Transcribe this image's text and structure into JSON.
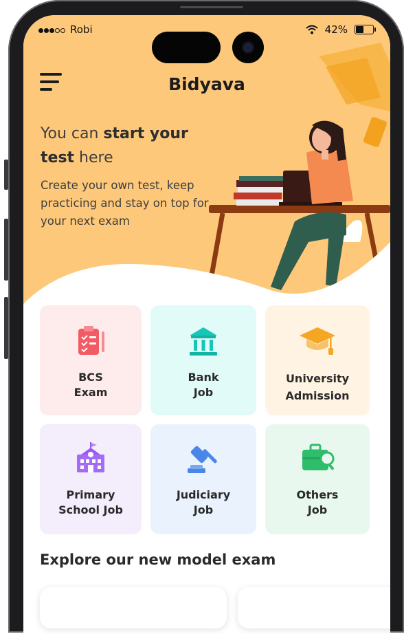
{
  "status_bar": {
    "carrier": "Robi",
    "battery": "42%"
  },
  "header": {
    "title": "Bidyava"
  },
  "hero": {
    "headline_prefix": "You can ",
    "headline_bold_1": "start your",
    "headline_bold_2": "test",
    "headline_suffix": " here",
    "subtext": "Create your own test, keep practicing and stay on top for your next exam"
  },
  "categories": [
    {
      "line1": "BCS",
      "line2": "Exam",
      "icon": "clipboard-checklist-icon",
      "bg": "#fdeceb"
    },
    {
      "line1": "Bank",
      "line2": "Job",
      "icon": "bank-building-icon",
      "bg": "#e1fbf8"
    },
    {
      "line1": "University",
      "line2": "Admission",
      "icon": "graduation-cap-icon",
      "bg": "#fff4e4"
    },
    {
      "line1": "Primary",
      "line2": "School Job",
      "icon": "school-building-icon",
      "bg": "#f3edfc"
    },
    {
      "line1": "Judiciary",
      "line2": "Job",
      "icon": "gavel-icon",
      "bg": "#eaf3fd"
    },
    {
      "line1": "Others",
      "line2": "Job",
      "icon": "briefcase-search-icon",
      "bg": "#e9f8ee"
    }
  ],
  "explore": {
    "title": "Explore our new model exam"
  },
  "colors": {
    "hero_bg": "#fdc87a",
    "accent": "#f5a623",
    "text": "#2a2a2a"
  }
}
